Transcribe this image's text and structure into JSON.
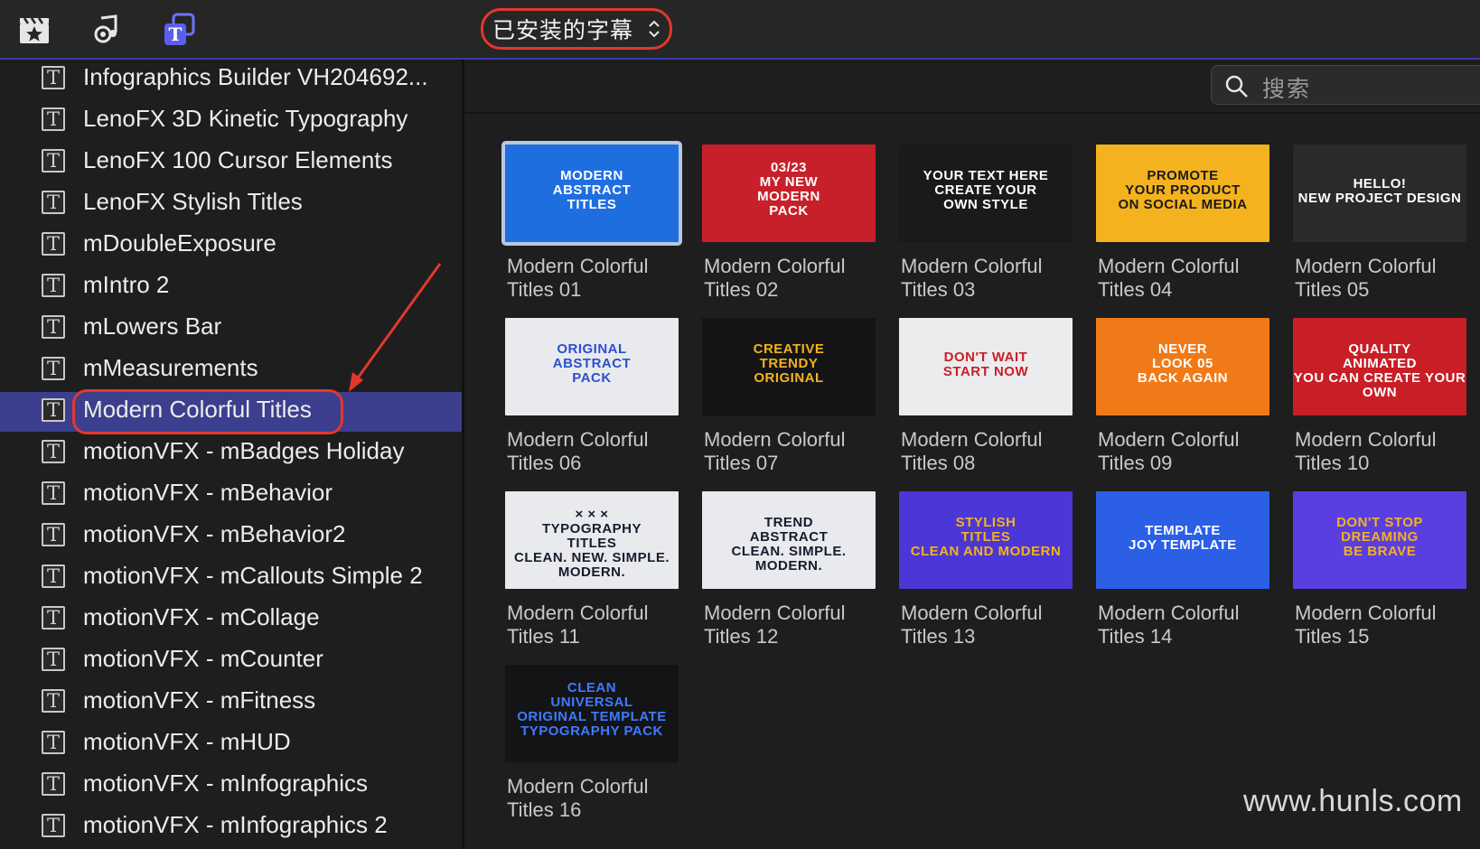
{
  "library": {
    "selected": "已安装的字幕"
  },
  "search": {
    "placeholder": "搜索"
  },
  "sidebar": {
    "items": [
      {
        "label": "Infographics Builder VH204692..."
      },
      {
        "label": "LenoFX 3D Kinetic Typography"
      },
      {
        "label": "LenoFX 100 Cursor Elements"
      },
      {
        "label": "LenoFX Stylish Titles"
      },
      {
        "label": "mDoubleExposure"
      },
      {
        "label": "mIntro 2"
      },
      {
        "label": "mLowers Bar"
      },
      {
        "label": "mMeasurements"
      },
      {
        "label": "Modern Colorful Titles",
        "selected": true
      },
      {
        "label": "motionVFX - mBadges Holiday"
      },
      {
        "label": "motionVFX - mBehavior"
      },
      {
        "label": "motionVFX - mBehavior2"
      },
      {
        "label": "motionVFX - mCallouts Simple 2"
      },
      {
        "label": "motionVFX - mCollage"
      },
      {
        "label": "motionVFX - mCounter"
      },
      {
        "label": "motionVFX - mFitness"
      },
      {
        "label": "motionVFX - mHUD"
      },
      {
        "label": "motionVFX - mInfographics"
      },
      {
        "label": "motionVFX - mInfographics 2"
      }
    ]
  },
  "tiles": [
    {
      "name": "Modern Colorful\nTitles 01",
      "thumb": "MODERN\nABSTRACT\nTITLES",
      "bg": "#1f6ee0",
      "fg": "#ffffff",
      "active": true
    },
    {
      "name": "Modern Colorful\nTitles 02",
      "thumb": "03/23\nMY NEW\nMODERN\nPACK",
      "bg": "#c8202a",
      "fg": "#ffffff"
    },
    {
      "name": "Modern Colorful\nTitles 03",
      "thumb": "YOUR TEXT HERE\nCREATE YOUR\nOWN STYLE",
      "bg": "#1a1a1c",
      "fg": "#ffffff"
    },
    {
      "name": "Modern Colorful\nTitles 04",
      "thumb": "PROMOTE\nYOUR PRODUCT\nON SOCIAL MEDIA",
      "bg": "#f4b21f",
      "fg": "#1a1a1a"
    },
    {
      "name": "Modern Colorful\nTitles 05",
      "thumb": "HELLO!\nNEW PROJECT DESIGN",
      "bg": "#2a2a2d",
      "fg": "#ffffff"
    },
    {
      "name": "Modern Colorful\nTitles 06",
      "thumb": "ORIGINAL\nABSTRACT\nPACK",
      "bg": "#e9eaee",
      "fg": "#2a4fd0"
    },
    {
      "name": "Modern Colorful\nTitles 07",
      "thumb": "CREATIVE\nTRENDY\nORIGINAL",
      "bg": "#141416",
      "fg": "#f2b31c"
    },
    {
      "name": "Modern Colorful\nTitles 08",
      "thumb": "DON'T WAIT\nSTART NOW",
      "bg": "#ececee",
      "fg": "#c8202a"
    },
    {
      "name": "Modern Colorful\nTitles 09",
      "thumb": "NEVER\nLOOK 05\nBACK AGAIN",
      "bg": "#f07a18",
      "fg": "#ffffff"
    },
    {
      "name": "Modern Colorful\nTitles 10",
      "thumb": "QUALITY\nANIMATED\nYOU CAN CREATE YOUR OWN",
      "bg": "#c81e26",
      "fg": "#ffffff"
    },
    {
      "name": "Modern Colorful\nTitles 11",
      "thumb": "× × ×\nTYPOGRAPHY\nTITLES\nCLEAN. NEW. SIMPLE. MODERN.",
      "bg": "#e9eaee",
      "fg": "#1a1a2e"
    },
    {
      "name": "Modern Colorful\nTitles 12",
      "thumb": "TREND\nABSTRACT\nCLEAN. SIMPLE. MODERN.",
      "bg": "#e9eaee",
      "fg": "#1a1a2e"
    },
    {
      "name": "Modern Colorful\nTitles 13",
      "thumb": "STYLISH\nTITLES\nCLEAN AND MODERN",
      "bg": "#4b37d6",
      "fg": "#f4b21f"
    },
    {
      "name": "Modern Colorful\nTitles 14",
      "thumb": "TEMPLATE\nJOY TEMPLATE",
      "bg": "#2a5fe6",
      "fg": "#ffffff"
    },
    {
      "name": "Modern Colorful\nTitles 15",
      "thumb": "DON'T STOP\nDREAMING\nBE BRAVE",
      "bg": "#5a3fe0",
      "fg": "#f4b21f"
    },
    {
      "name": "Modern Colorful\nTitles 16",
      "thumb": "CLEAN\nUNIVERSAL\nORIGINAL TEMPLATE\nTYPOGRAPHY PACK",
      "bg": "#141416",
      "fg": "#3d7bff"
    }
  ],
  "watermark": "www.hunls.com",
  "colors": {
    "accent": "#3c3f8e",
    "highlight_ring": "#e2382c"
  }
}
